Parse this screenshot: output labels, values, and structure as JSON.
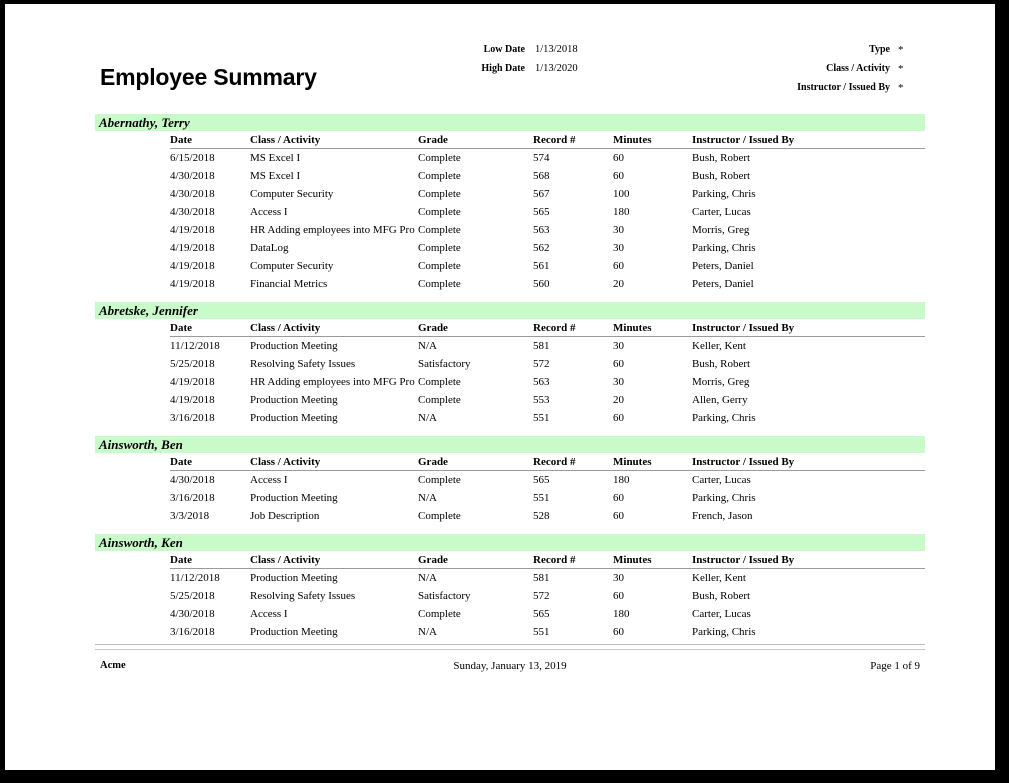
{
  "report": {
    "title": "Employee Summary",
    "parameters": {
      "low_date_label": "Low Date",
      "low_date_value": "1/13/2018",
      "high_date_label": "High Date",
      "high_date_value": "1/13/2020",
      "type_label": "Type",
      "type_value": "*",
      "class_activity_label": "Class / Activity",
      "class_activity_value": "*",
      "instructor_label": "Instructor / Issued By",
      "instructor_value": "*"
    },
    "columns": {
      "date": "Date",
      "class_activity": "Class / Activity",
      "grade": "Grade",
      "record": "Record #",
      "minutes": "Minutes",
      "instructor": "Instructor / Issued By"
    },
    "group_band_color": "#c9fac9",
    "groups": [
      {
        "name": "Abernathy, Terry",
        "rows": [
          {
            "date": "6/15/2018",
            "class": "MS Excel I",
            "grade": "Complete",
            "record": "574",
            "minutes": "60",
            "instructor": "Bush, Robert"
          },
          {
            "date": "4/30/2018",
            "class": "MS Excel I",
            "grade": "Complete",
            "record": "568",
            "minutes": "60",
            "instructor": "Bush, Robert"
          },
          {
            "date": "4/30/2018",
            "class": "Computer Security",
            "grade": "Complete",
            "record": "567",
            "minutes": "100",
            "instructor": "Parking, Chris"
          },
          {
            "date": "4/30/2018",
            "class": "Access I",
            "grade": "Complete",
            "record": "565",
            "minutes": "180",
            "instructor": "Carter, Lucas"
          },
          {
            "date": "4/19/2018",
            "class": "HR Adding employees into MFG Pro",
            "grade": "Complete",
            "record": "563",
            "minutes": "30",
            "instructor": "Morris, Greg"
          },
          {
            "date": "4/19/2018",
            "class": "DataLog",
            "grade": "Complete",
            "record": "562",
            "minutes": "30",
            "instructor": "Parking, Chris"
          },
          {
            "date": "4/19/2018",
            "class": "Computer Security",
            "grade": "Complete",
            "record": "561",
            "minutes": "60",
            "instructor": "Peters, Daniel"
          },
          {
            "date": "4/19/2018",
            "class": "Financial Metrics",
            "grade": "Complete",
            "record": "560",
            "minutes": "20",
            "instructor": "Peters, Daniel"
          }
        ]
      },
      {
        "name": "Abretske, Jennifer",
        "rows": [
          {
            "date": "11/12/2018",
            "class": "Production Meeting",
            "grade": "N/A",
            "record": "581",
            "minutes": "30",
            "instructor": "Keller, Kent"
          },
          {
            "date": "5/25/2018",
            "class": "Resolving Safety Issues",
            "grade": "Satisfactory",
            "record": "572",
            "minutes": "60",
            "instructor": "Bush, Robert"
          },
          {
            "date": "4/19/2018",
            "class": "HR Adding employees into MFG Pro",
            "grade": "Complete",
            "record": "563",
            "minutes": "30",
            "instructor": "Morris, Greg"
          },
          {
            "date": "4/19/2018",
            "class": "Production Meeting",
            "grade": "Complete",
            "record": "553",
            "minutes": "20",
            "instructor": "Allen, Gerry"
          },
          {
            "date": "3/16/2018",
            "class": "Production Meeting",
            "grade": "N/A",
            "record": "551",
            "minutes": "60",
            "instructor": "Parking, Chris"
          }
        ]
      },
      {
        "name": "Ainsworth, Ben",
        "rows": [
          {
            "date": "4/30/2018",
            "class": "Access I",
            "grade": "Complete",
            "record": "565",
            "minutes": "180",
            "instructor": "Carter, Lucas"
          },
          {
            "date": "3/16/2018",
            "class": "Production Meeting",
            "grade": "N/A",
            "record": "551",
            "minutes": "60",
            "instructor": "Parking, Chris"
          },
          {
            "date": "3/3/2018",
            "class": "Job Description",
            "grade": "Complete",
            "record": "528",
            "minutes": "60",
            "instructor": "French, Jason"
          }
        ]
      },
      {
        "name": "Ainsworth, Ken",
        "rows": [
          {
            "date": "11/12/2018",
            "class": "Production Meeting",
            "grade": "N/A",
            "record": "581",
            "minutes": "30",
            "instructor": "Keller, Kent"
          },
          {
            "date": "5/25/2018",
            "class": "Resolving Safety Issues",
            "grade": "Satisfactory",
            "record": "572",
            "minutes": "60",
            "instructor": "Bush, Robert"
          },
          {
            "date": "4/30/2018",
            "class": "Access I",
            "grade": "Complete",
            "record": "565",
            "minutes": "180",
            "instructor": "Carter, Lucas"
          },
          {
            "date": "3/16/2018",
            "class": "Production Meeting",
            "grade": "N/A",
            "record": "551",
            "minutes": "60",
            "instructor": "Parking, Chris"
          }
        ]
      }
    ],
    "footer": {
      "left": "Acme",
      "center": "Sunday, January 13, 2019",
      "right": "Page 1 of 9"
    }
  }
}
